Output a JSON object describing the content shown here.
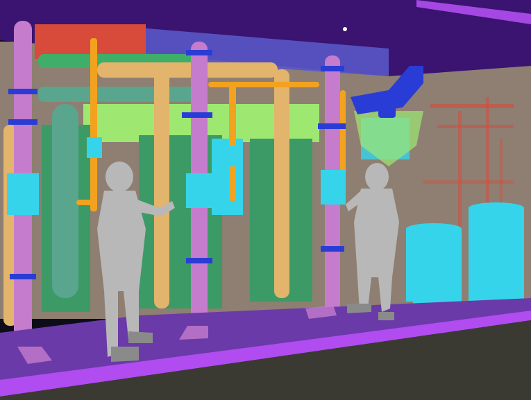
{
  "scene": {
    "colors": {
      "ceiling": "#3a1470",
      "ceiling_band": "#5a56c8",
      "back_wall": "#8e7f72",
      "floor": "#6a3aa8",
      "floor_edge": "#b04cf0",
      "ground": "#3b3a32",
      "pipe_pink": "#c57ccc",
      "pipe_orange": "#f2a21f",
      "pipe_tan": "#e2b46c",
      "pipe_teal": "#5aa58e",
      "pipe_green": "#3fae68",
      "pipe_blue": "#2a3cd6",
      "pipe_red": "#d84a3a",
      "cyan_block": "#36d4ea",
      "green_cabinet": "#3c9a66",
      "lime_panel": "#9ee872",
      "figure": "#b8b8b8",
      "figure_shadow": "#8a8a8a"
    }
  }
}
